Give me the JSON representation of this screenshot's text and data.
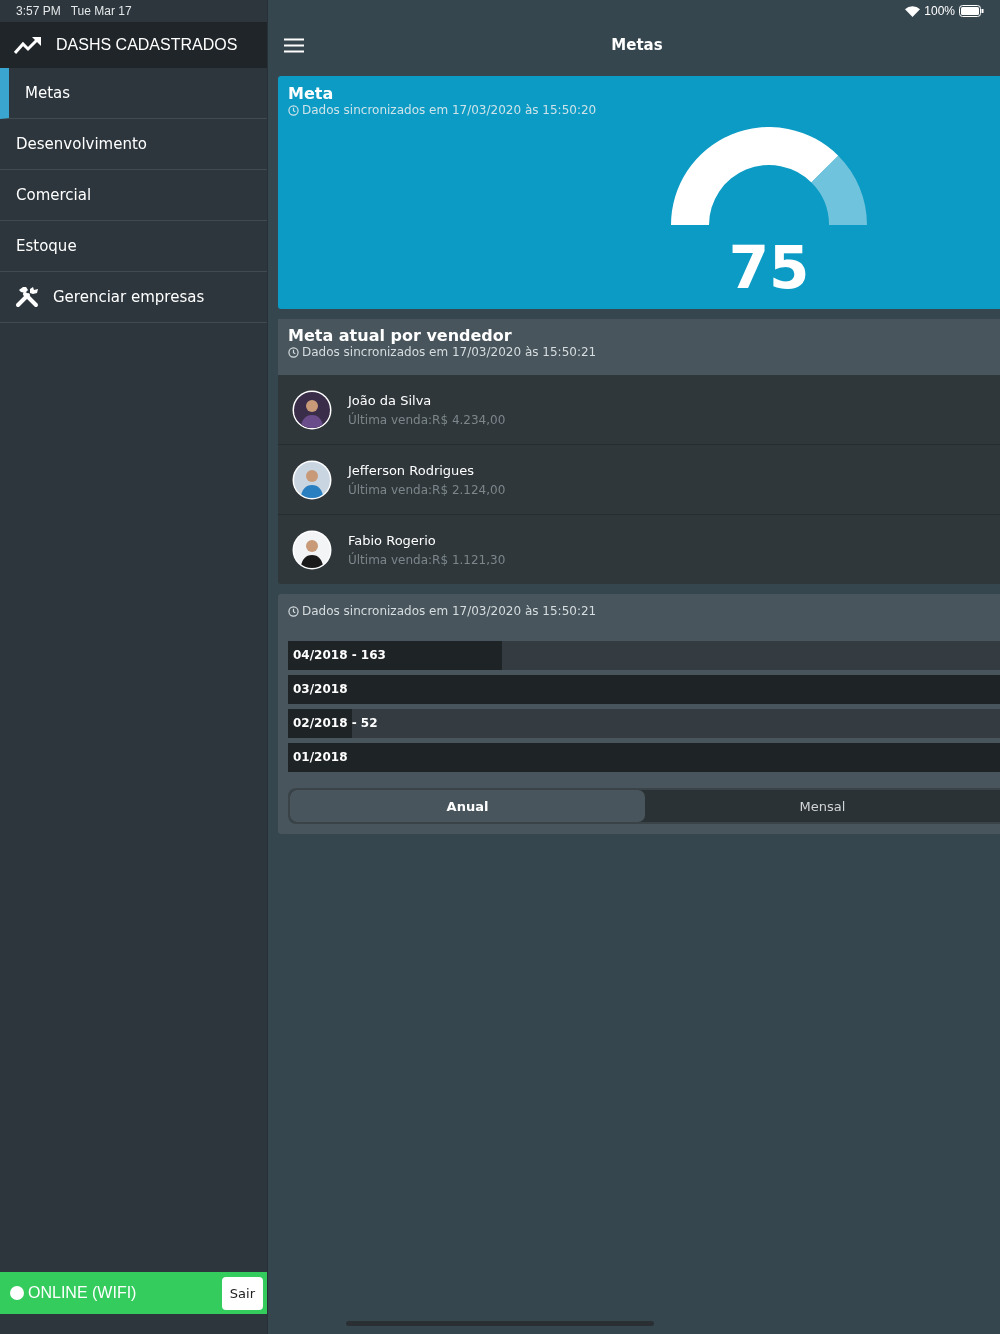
{
  "status_bar": {
    "time": "3:57 PM",
    "date": "Tue Mar 17",
    "battery": "100%"
  },
  "sidebar": {
    "title": "DASHS CADASTRADOS",
    "items": [
      {
        "label": "Metas",
        "selected": true,
        "kind": "plain"
      },
      {
        "label": "Desenvolvimento",
        "selected": false,
        "kind": "plain"
      },
      {
        "label": "Comercial",
        "selected": false,
        "kind": "plain"
      },
      {
        "label": "Estoque",
        "selected": false,
        "kind": "plain"
      },
      {
        "label": "Gerenciar empresas",
        "selected": false,
        "kind": "tools"
      }
    ]
  },
  "connection": {
    "label": "ONLINE (WIFI)",
    "online": true,
    "button": "Sair"
  },
  "header": {
    "title": "Metas"
  },
  "meta_card": {
    "title": "Meta",
    "sync": "Dados sincronizados em 17/03/2020 às 15:50:20",
    "gauge": {
      "level": 0.75,
      "value": "75"
    }
  },
  "sellers_card": {
    "title": "Meta atual por vendedor",
    "sync": "Dados sincronizados em 17/03/2020 às 15:50:21",
    "sellers": [
      {
        "name": "João da Silva",
        "last_sale": "Última venda:R$ 4.234,00"
      },
      {
        "name": "Jefferson Rodrigues",
        "last_sale": "Última venda:R$ 2.124,00"
      },
      {
        "name": "Fabio Rogerio",
        "last_sale": "Última venda:R$ 1.121,30"
      }
    ]
  },
  "bars_card": {
    "sync": "Dados sincronizados em 17/03/2020 às 15:50:21",
    "bars": [
      {
        "label": "04/2018 - 163",
        "level": 0.3
      },
      {
        "label": "03/2018",
        "level": 1
      },
      {
        "label": "02/2018 - 52",
        "level": 0.09
      },
      {
        "label": "01/2018",
        "level": 1
      }
    ],
    "segments": [
      {
        "label": "Anual",
        "selected": true
      },
      {
        "label": "Mensal",
        "selected": false
      }
    ]
  }
}
